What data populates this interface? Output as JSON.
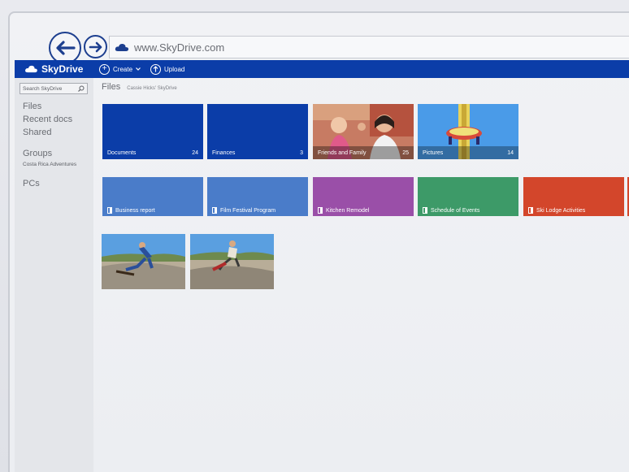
{
  "browser": {
    "url": "www.SkyDrive.com",
    "back_icon": "arrow-left-icon",
    "forward_icon": "arrow-right-icon"
  },
  "app": {
    "brand": "SkyDrive",
    "create_label": "Create",
    "upload_label": "Upload",
    "brand_color": "#0b3da8"
  },
  "sidebar": {
    "search_placeholder": "Search SkyDrive",
    "files": "Files",
    "recent": "Recent docs",
    "shared": "Shared",
    "groups": "Groups",
    "group_item": "Costa Rica Adventures",
    "pcs": "PCs"
  },
  "main": {
    "title": "Files",
    "path": "Cassie Hicks' SkyDrive",
    "folders": [
      {
        "label": "Documents",
        "count": "24",
        "color": "#0b3da8"
      },
      {
        "label": "Finances",
        "count": "3",
        "color": "#0b3da8"
      },
      {
        "label": "Friends and Family",
        "count": "25"
      },
      {
        "label": "Pictures",
        "count": "14"
      }
    ],
    "docs": [
      {
        "label": "Business report",
        "color": "#4a7cc9"
      },
      {
        "label": "Film Festival Program",
        "color": "#4a7cc9"
      },
      {
        "label": "Kitchen Remodel",
        "color": "#9a4fa8"
      },
      {
        "label": "Schedule of Events",
        "color": "#3d9a68"
      },
      {
        "label": "Ski Lodge Activities",
        "color": "#d3462b"
      }
    ]
  }
}
